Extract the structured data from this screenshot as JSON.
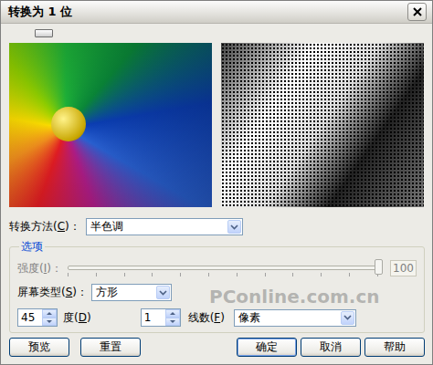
{
  "window": {
    "title": "转换为 1 位"
  },
  "method": {
    "label": "转换方法(C)：",
    "value": "半色调"
  },
  "options": {
    "legend": "选项",
    "intensity": {
      "label": "强度(I)：",
      "level": 1,
      "reading": "100",
      "disabled": true
    },
    "screen_type": {
      "label": "屏幕类型(S)：",
      "value": "方形"
    },
    "angle": {
      "value": "45",
      "unit": "度(D)"
    },
    "lines": {
      "value": "1",
      "label": "线数(F)",
      "unit": "像素"
    }
  },
  "watermark": "PConline.com.cn",
  "buttons": [
    {
      "label": "预览",
      "group": "left",
      "default": false
    },
    {
      "label": "重置",
      "group": "left",
      "default": false
    },
    {
      "label": "确定",
      "group": "right",
      "default": true
    },
    {
      "label": "取消",
      "group": "right",
      "default": false
    },
    {
      "label": "帮助",
      "group": "right",
      "default": false
    }
  ]
}
